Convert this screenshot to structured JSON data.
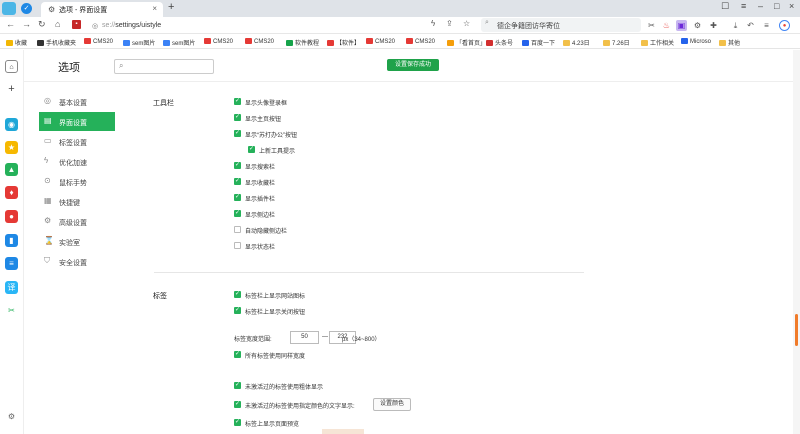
{
  "browser": {
    "tab_title": "选项 - 界面设置",
    "url_scheme": "se://",
    "url_path": "settings/uistyle",
    "search_text": "德企争籍团访华寄位"
  },
  "bookmarks": [
    {
      "label": "收藏",
      "color": "#f2b705"
    },
    {
      "label": "手机收藏夹",
      "color": "#333333"
    },
    {
      "label": "CMS20",
      "color": "#e53935"
    },
    {
      "label": "sem图片",
      "color": "#3b82f6"
    },
    {
      "label": "sem图片",
      "color": "#3b82f6"
    },
    {
      "label": "CMS20",
      "color": "#e53935"
    },
    {
      "label": "CMS20",
      "color": "#e53935"
    },
    {
      "label": "软件教程",
      "color": "#16a34a"
    },
    {
      "label": "【软件】",
      "color": "#e53935"
    },
    {
      "label": "CMS20",
      "color": "#e53935"
    },
    {
      "label": "CMS20",
      "color": "#e53935"
    },
    {
      "label": "「看首页」",
      "color": "#f59e0b"
    },
    {
      "label": "头条号",
      "color": "#d32f2f"
    },
    {
      "label": "百度一下",
      "color": "#2563eb"
    },
    {
      "label": "4.23日",
      "color": "#f2c04a"
    },
    {
      "label": "7.26日",
      "color": "#f2c04a"
    },
    {
      "label": "工作相关",
      "color": "#f2c04a"
    },
    {
      "label": "Microso",
      "color": "#2563eb"
    },
    {
      "label": "其他",
      "color": "#f2c04a"
    }
  ],
  "header": {
    "title": "选项",
    "search_placeholder": "",
    "toast": "设置保存成功"
  },
  "sidebar": {
    "items": [
      {
        "label": "基本设置",
        "icon": "gear-icon",
        "active": false
      },
      {
        "label": "界面设置",
        "icon": "layout-icon",
        "active": true
      },
      {
        "label": "标签设置",
        "icon": "tab-icon",
        "active": false
      },
      {
        "label": "优化加速",
        "icon": "lightning-icon",
        "active": false
      },
      {
        "label": "鼠标手势",
        "icon": "mouse-icon",
        "active": false
      },
      {
        "label": "快捷键",
        "icon": "keyboard-icon",
        "active": false
      },
      {
        "label": "高级设置",
        "icon": "settings-advanced-icon",
        "active": false
      },
      {
        "label": "实验室",
        "icon": "flask-icon",
        "active": false
      },
      {
        "label": "安全设置",
        "icon": "shield-icon",
        "active": false
      }
    ]
  },
  "toolbar_section": {
    "title": "工具栏",
    "options": [
      {
        "label": "显示头像登录框",
        "checked": true
      },
      {
        "label": "显示主页按钮",
        "checked": true
      },
      {
        "label": "显示“苏打办公”按钮",
        "checked": true
      },
      {
        "label": "上新工具提示",
        "checked": true,
        "indent": true
      },
      {
        "label": "显示搜索栏",
        "checked": true
      },
      {
        "label": "显示收藏栏",
        "checked": true
      },
      {
        "label": "显示插件栏",
        "checked": true
      },
      {
        "label": "显示侧边栏",
        "checked": true
      },
      {
        "label": "自动隐藏侧边栏",
        "checked": false
      },
      {
        "label": "显示状态栏",
        "checked": false
      }
    ]
  },
  "tabs_section": {
    "title": "标签",
    "options": [
      {
        "label": "标签栏上显示网站图标",
        "checked": true
      },
      {
        "label": "标签栏上显示关闭按钮",
        "checked": true
      }
    ],
    "width_label": "标签宽度范围:",
    "width_min": "50",
    "width_sep": "—",
    "width_max": "232",
    "width_unit": "px（34~800）",
    "same_width": "所有标签使用同样宽度",
    "inactive_bold": "未激活过的标签使用粗体显示",
    "inactive_color": "未激活过的标签使用指定颜色的文字显示:",
    "color_button": "设置颜色",
    "preview": "标签上显示页面预览"
  },
  "colors": {
    "accent": "#25b15a",
    "scroll_thumb": "#f07b2a"
  }
}
